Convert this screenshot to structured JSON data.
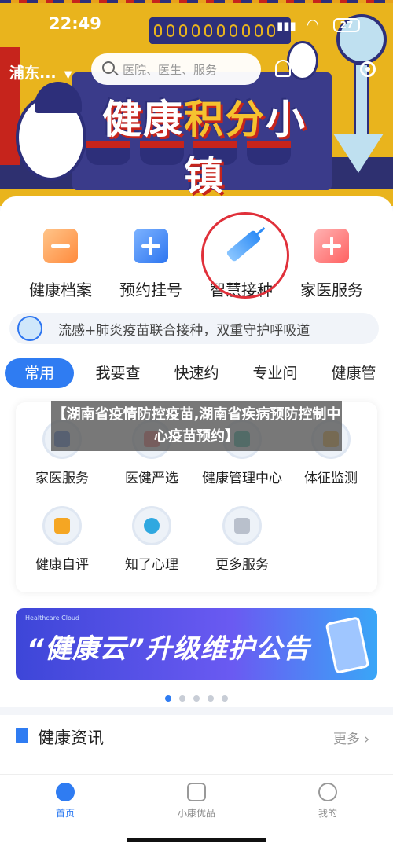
{
  "status_bar": {
    "time": "22:49",
    "battery": "27"
  },
  "header": {
    "location": "浦东...",
    "search_placeholder": "医院、医生、服务"
  },
  "banner": {
    "title_part1": "健康",
    "title_part2": "积分",
    "title_part3": "小镇"
  },
  "quick_actions": [
    {
      "label": "健康档案",
      "icon": "health-record-icon"
    },
    {
      "label": "预约挂号",
      "icon": "appointment-icon"
    },
    {
      "label": "智慧接种",
      "icon": "vaccine-syringe-icon"
    },
    {
      "label": "家医服务",
      "icon": "family-doctor-icon"
    }
  ],
  "notice": {
    "text": "流感+肺炎疫苗联合接种，双重守护呼吸道"
  },
  "tabs": [
    "常用",
    "我要查",
    "快速约",
    "专业问",
    "健康管"
  ],
  "services": [
    {
      "label": "家医服务"
    },
    {
      "label": "医健严选"
    },
    {
      "label": "健康管理中心"
    },
    {
      "label": "体征监测"
    },
    {
      "label": "健康自评"
    },
    {
      "label": "知了心理"
    },
    {
      "label": "更多服务"
    }
  ],
  "overlay_caption": "【湖南省疫情防控疫苗,湖南省疾病预防控制中心疫苗预约】",
  "promo": {
    "brand": "Healthcare Cloud",
    "text": "“健康云”升级维护公告"
  },
  "news": {
    "title": "健康资讯",
    "more": "更多 ›"
  },
  "bottom_nav": [
    {
      "label": "首页",
      "active": true
    },
    {
      "label": "小康优品",
      "active": false
    },
    {
      "label": "我的",
      "active": false
    }
  ],
  "colors": {
    "accent": "#2f7cf2",
    "banner_yellow": "#e9b41d",
    "banner_navy": "#2d2f7a",
    "highlight_red": "#e0303a"
  }
}
